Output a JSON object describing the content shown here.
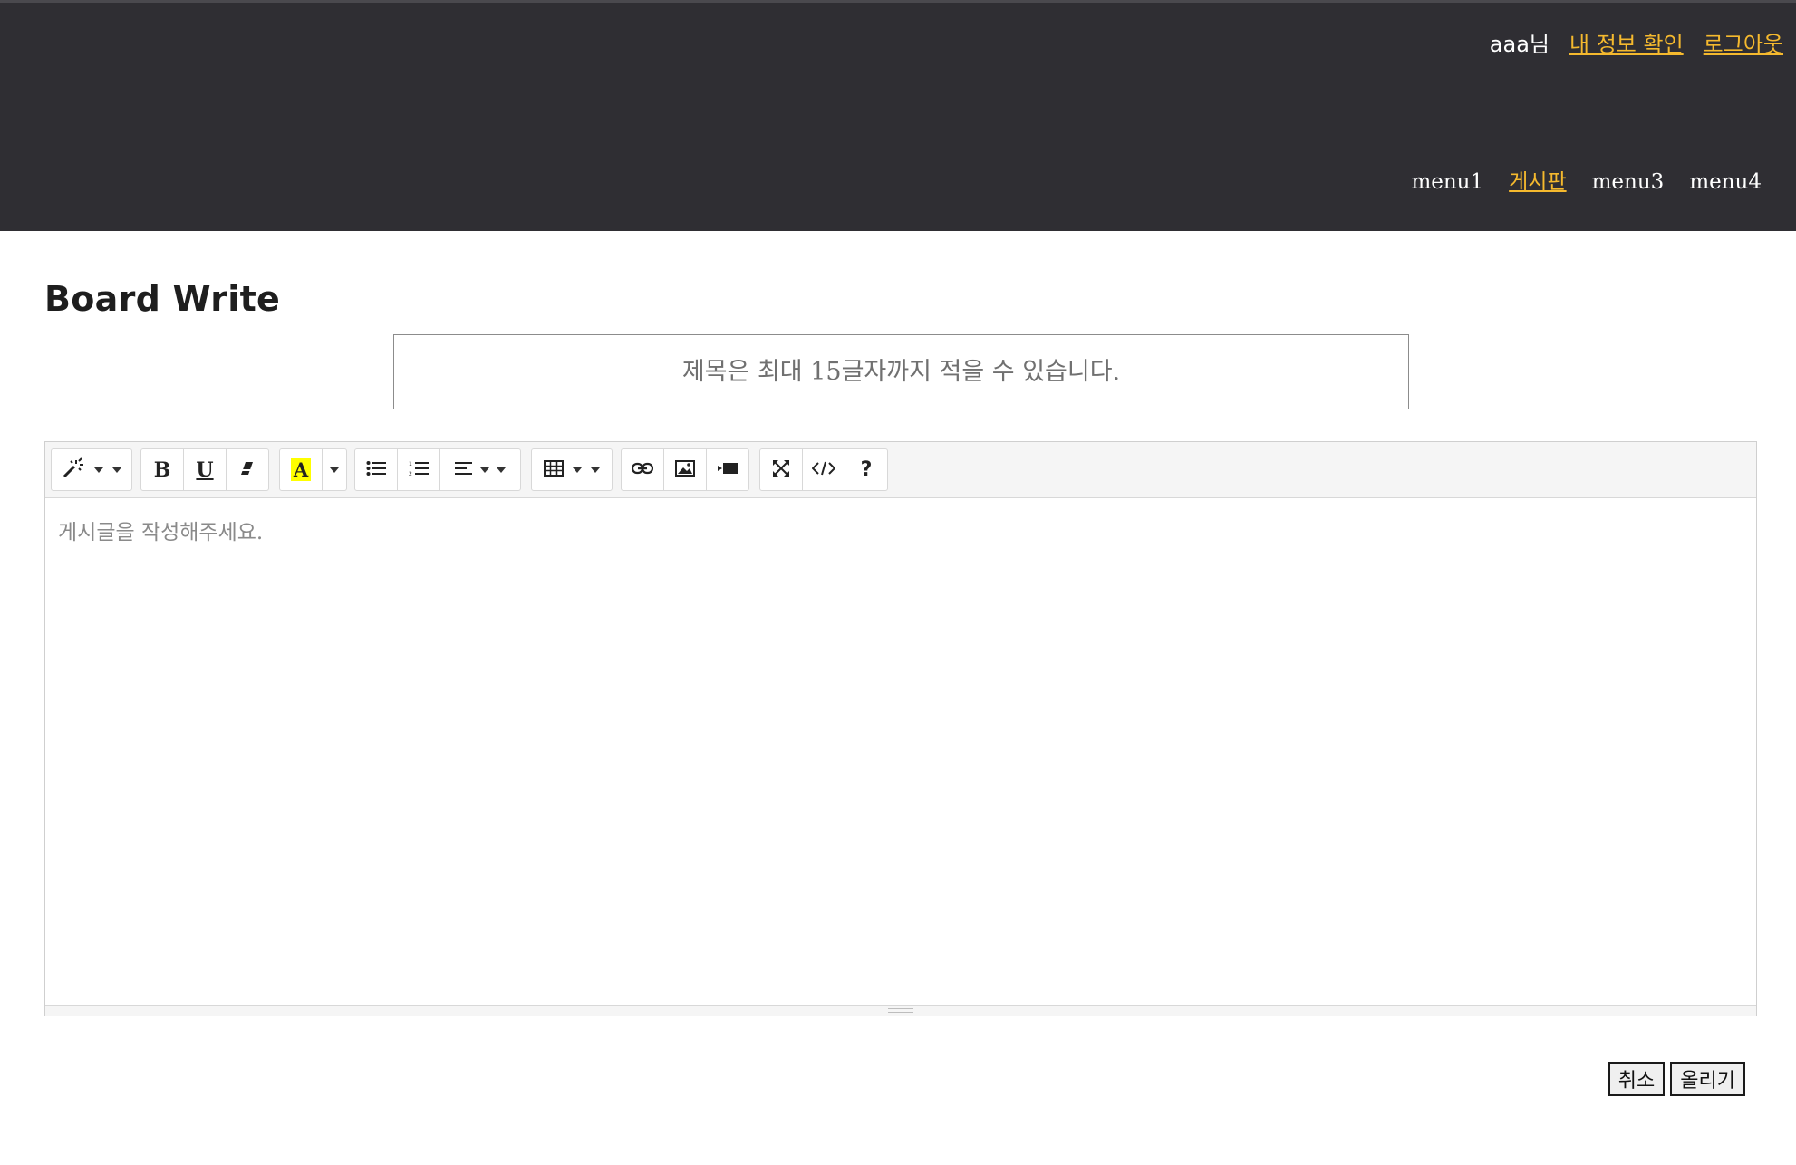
{
  "header": {
    "user_name": "aaa님",
    "links": [
      "내 정보 확인",
      "로그아웃"
    ],
    "nav": [
      {
        "label": "menu1",
        "active": false
      },
      {
        "label": "게시판",
        "active": true
      },
      {
        "label": "menu3",
        "active": false
      },
      {
        "label": "menu4",
        "active": false
      }
    ]
  },
  "page": {
    "title": "Board Write",
    "title_placeholder": "제목은 최대 15글자까지 적을 수 있습니다.",
    "content_placeholder": "게시글을 작성해주세요."
  },
  "toolbar": {
    "icons": [
      "magic-wand-icon",
      "bold-icon",
      "underline-icon",
      "eraser-icon",
      "font-color-icon",
      "unordered-list-icon",
      "ordered-list-icon",
      "align-icon",
      "table-icon",
      "link-icon",
      "picture-icon",
      "video-icon",
      "fullscreen-icon",
      "code-view-icon",
      "help-icon"
    ],
    "highlight_color": "#ffff00"
  },
  "actions": {
    "cancel_label": "취소",
    "submit_label": "올리기"
  },
  "colors": {
    "header_bg": "#2f2e33",
    "accent": "#f5b92e"
  }
}
